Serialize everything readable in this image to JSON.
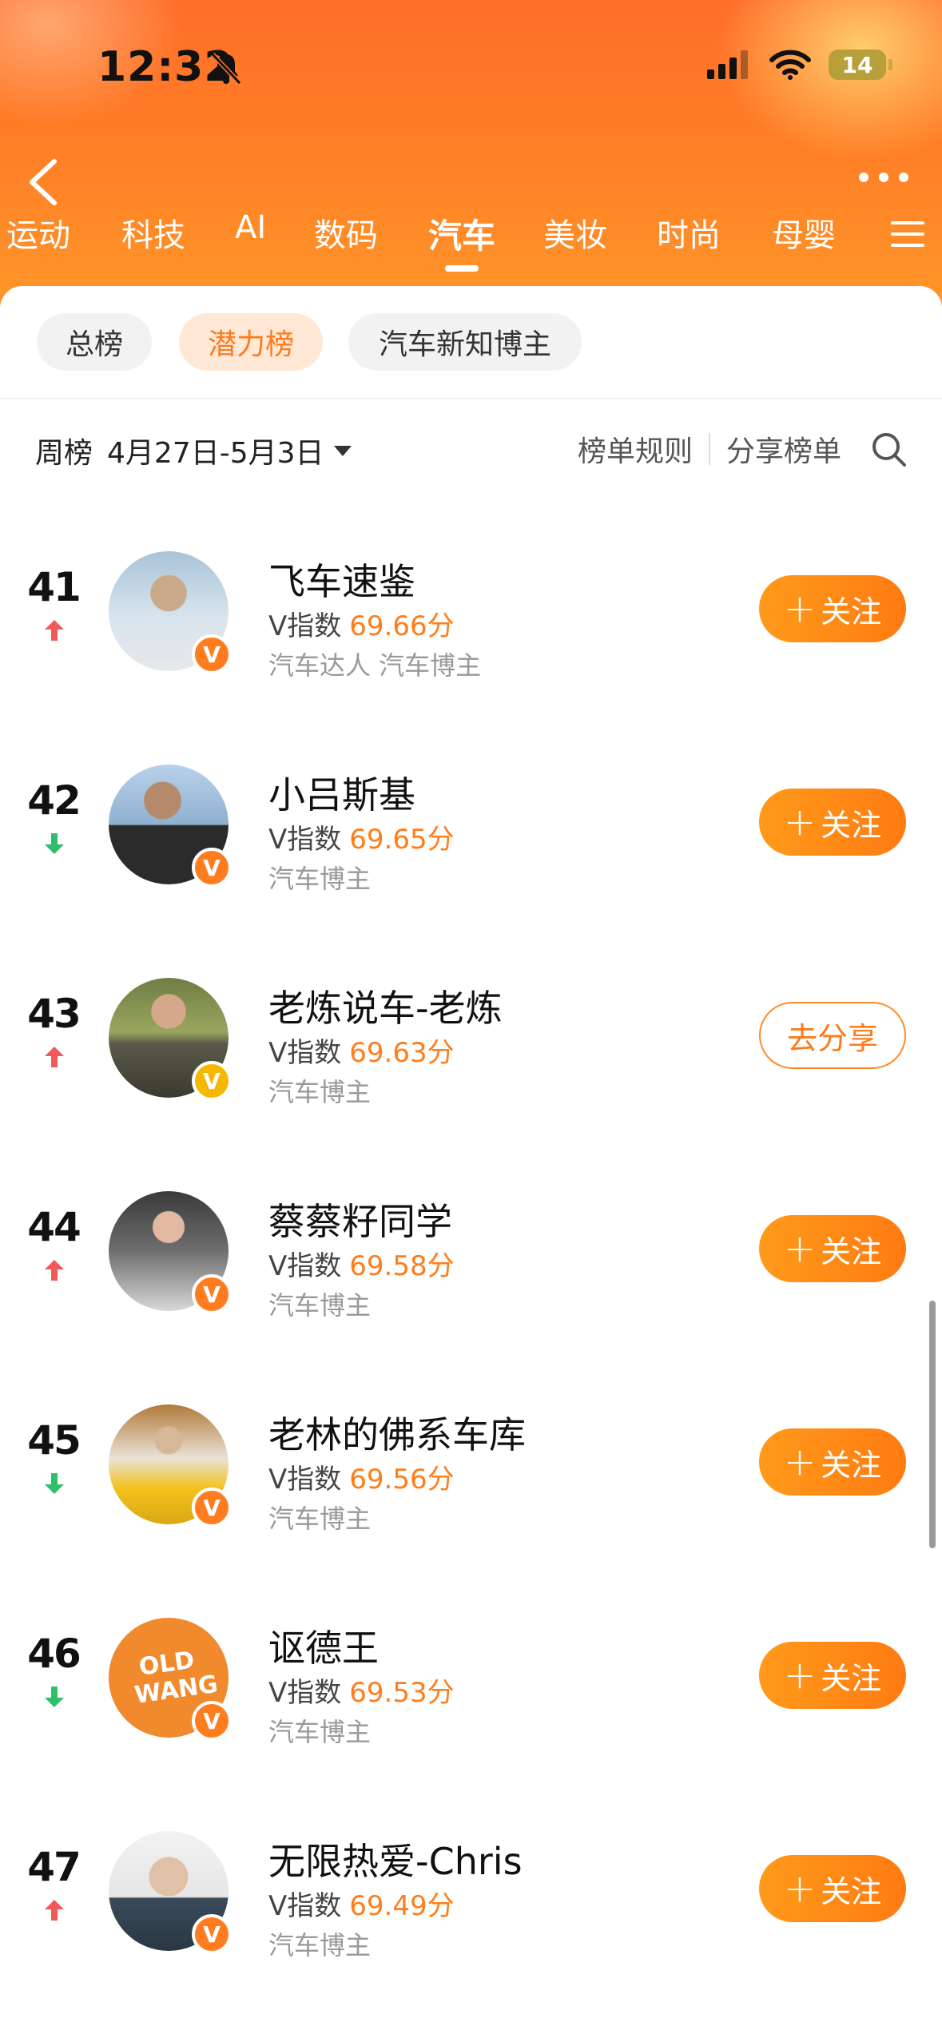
{
  "status_bar": {
    "time": "12:32",
    "battery": "14"
  },
  "nav": {
    "tabs": [
      "运动",
      "科技",
      "AI",
      "数码",
      "汽车",
      "美妆",
      "时尚",
      "母婴"
    ],
    "active_tab": "汽车"
  },
  "chips": [
    "总榜",
    "潜力榜",
    "汽车新知博主"
  ],
  "active_chip": "潜力榜",
  "week": {
    "label": "周榜",
    "range": "4月27日-5月3日"
  },
  "tools": {
    "rules": "榜单规则",
    "share": "分享榜单"
  },
  "colors": {
    "accent": "#ff7d1a",
    "up": "#f25a5a",
    "down": "#2fbf6a",
    "badge_gold": "#f5b800"
  },
  "rows": [
    {
      "rank": "41",
      "trend": "up",
      "name": "飞车速鉴",
      "v_label": "V指数",
      "score": "69.66分",
      "tags": "汽车达人 汽车博主",
      "button": "关注",
      "button_type": "follow",
      "badge": "V"
    },
    {
      "rank": "42",
      "trend": "down",
      "name": "小吕斯基",
      "v_label": "V指数",
      "score": "69.65分",
      "tags": "汽车博主",
      "button": "关注",
      "button_type": "follow",
      "badge": "V"
    },
    {
      "rank": "43",
      "trend": "up",
      "name": "老炼说车-老炼",
      "v_label": "V指数",
      "score": "69.63分",
      "tags": "汽车博主",
      "button": "去分享",
      "button_type": "share",
      "badge": "V"
    },
    {
      "rank": "44",
      "trend": "up",
      "name": "蔡蔡籽同学",
      "v_label": "V指数",
      "score": "69.58分",
      "tags": "汽车博主",
      "button": "关注",
      "button_type": "follow",
      "badge": "V"
    },
    {
      "rank": "45",
      "trend": "down",
      "name": "老林的佛系车库",
      "v_label": "V指数",
      "score": "69.56分",
      "tags": "汽车博主",
      "button": "关注",
      "button_type": "follow",
      "badge": "V"
    },
    {
      "rank": "46",
      "trend": "down",
      "name": "讴德王",
      "v_label": "V指数",
      "score": "69.53分",
      "tags": "汽车博主",
      "button": "关注",
      "button_type": "follow",
      "badge": "V",
      "avatar_text": "OLD WANG"
    },
    {
      "rank": "47",
      "trend": "up",
      "name": "无限热爱-Chris",
      "v_label": "V指数",
      "score": "69.49分",
      "tags": "汽车博主",
      "button": "关注",
      "button_type": "follow",
      "badge": "V"
    }
  ]
}
